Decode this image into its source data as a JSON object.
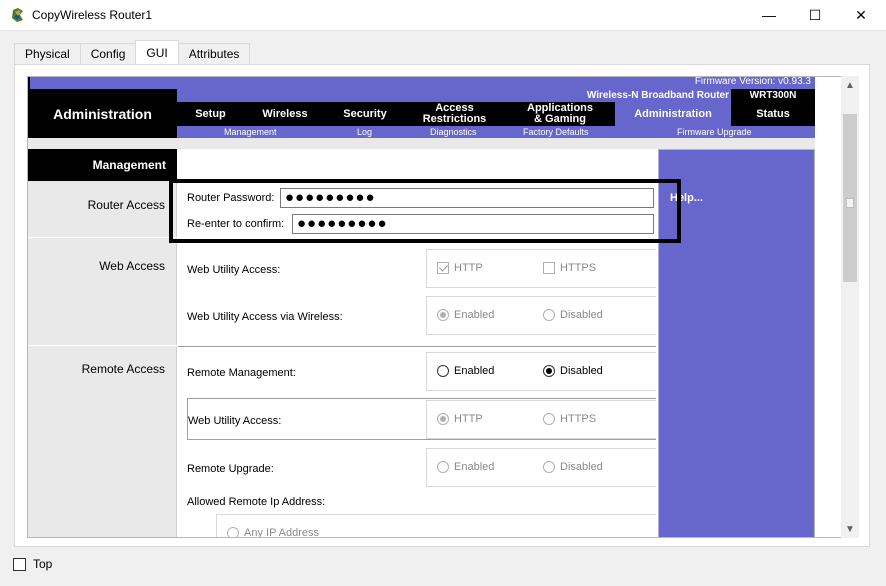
{
  "window": {
    "title": "CopyWireless Router1",
    "controls": {
      "minimize": "—",
      "maximize": "☐",
      "close": "✕"
    }
  },
  "tabs": [
    {
      "label": "Physical",
      "active": false
    },
    {
      "label": "Config",
      "active": false
    },
    {
      "label": "GUI",
      "active": true
    },
    {
      "label": "Attributes",
      "active": false
    }
  ],
  "router": {
    "firmware": "Firmware Version: v0.93.3",
    "page_title": "Administration",
    "product_name": "Wireless-N Broadband Router",
    "model": "WRT300N",
    "nav": [
      {
        "label": "Setup"
      },
      {
        "label": "Wireless"
      },
      {
        "label": "Security"
      },
      {
        "label": "Access Restrictions"
      },
      {
        "label": "Applications & Gaming"
      },
      {
        "label": "Administration",
        "active": true
      },
      {
        "label": "Status"
      }
    ],
    "subnav": [
      "Management",
      "Log",
      "Diagnostics",
      "Factory Defaults",
      "Firmware Upgrade"
    ]
  },
  "management": {
    "section": "Management",
    "router_access": {
      "label": "Router Access",
      "password_label": "Router Password:",
      "password_value": "●●●●●●●●●",
      "confirm_label": "Re-enter to confirm:",
      "confirm_value": "●●●●●●●●●"
    },
    "web_access": {
      "label": "Web Access",
      "utility_label": "Web Utility Access:",
      "http": "HTTP",
      "https": "HTTPS",
      "wireless_label": "Web Utility Access via Wireless:",
      "enabled": "Enabled",
      "disabled": "Disabled"
    },
    "remote_access": {
      "label": "Remote Access",
      "mgmt_label": "Remote Management:",
      "enabled": "Enabled",
      "disabled": "Disabled",
      "utility_label": "Web Utility Access:",
      "http": "HTTP",
      "https": "HTTPS",
      "upgrade_label": "Remote Upgrade:",
      "allowed_ip_label": "Allowed Remote Ip Address:",
      "any_ip": "Any IP Address"
    }
  },
  "help": {
    "link": "Help..."
  },
  "footer": {
    "top_label": "Top"
  }
}
